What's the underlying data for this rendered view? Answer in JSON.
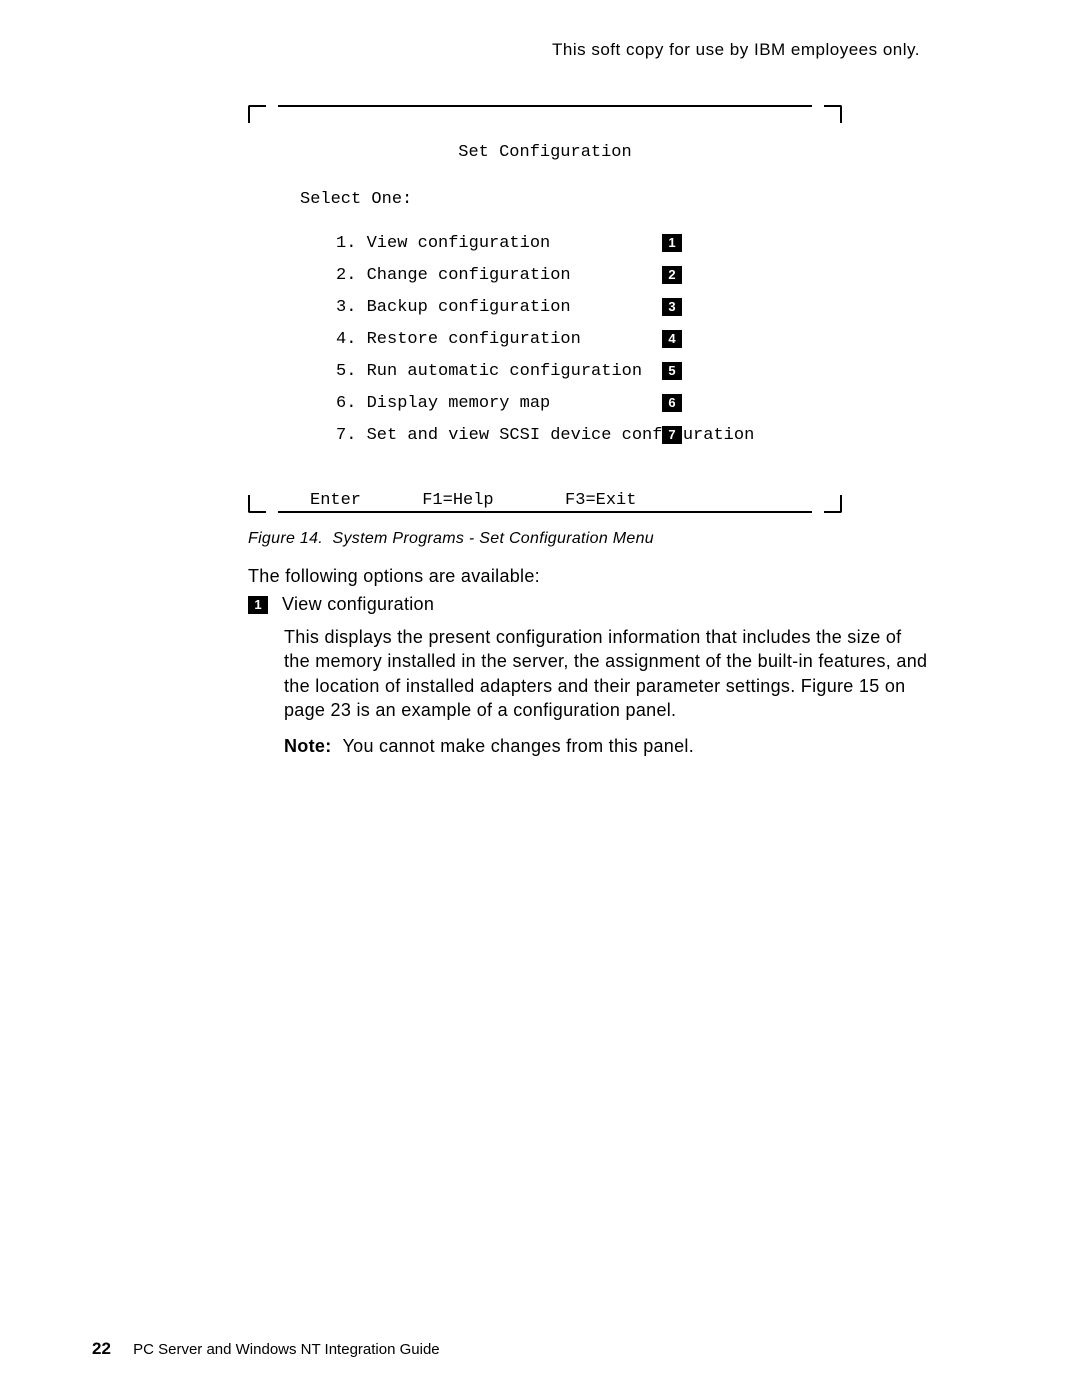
{
  "header": {
    "note": "This soft copy for use by IBM employees only."
  },
  "panel": {
    "title": "Set Configuration",
    "select_label": "Select One:",
    "items": [
      {
        "num": "1",
        "label": "1. View configuration"
      },
      {
        "num": "2",
        "label": "2. Change configuration"
      },
      {
        "num": "3",
        "label": "3. Backup configuration"
      },
      {
        "num": "4",
        "label": "4. Restore configuration"
      },
      {
        "num": "5",
        "label": "5. Run automatic configuration"
      },
      {
        "num": "6",
        "label": "6. Display memory map"
      },
      {
        "num": "7",
        "label": "7. Set and view SCSI device configuration"
      }
    ],
    "footer": "Enter      F1=Help       F3=Exit"
  },
  "caption": "Figure 14.  System Programs - Set Configuration Menu",
  "body": {
    "intro": "The following options are available:",
    "item1": {
      "num": "1",
      "title": "View configuration",
      "para": "This displays the present configuration information that includes the size of the memory installed in the server, the assignment of the built-in features, and the location of installed adapters and their parameter settings. Figure 15 on page 23 is an example of a configuration panel.",
      "note_label": "Note:",
      "note_text": "You cannot make changes from this panel."
    }
  },
  "footer": {
    "page_number": "22",
    "book_title": "PC Server and Windows NT Integration Guide"
  }
}
